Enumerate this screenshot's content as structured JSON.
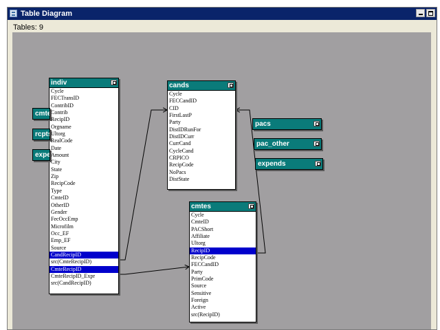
{
  "window": {
    "title": "Table Diagram"
  },
  "status": {
    "tables_label": "Tables: 9"
  },
  "tables": {
    "indiv": {
      "name": "indiv",
      "fields": [
        "Cycle",
        "FECTransID",
        "ContribID",
        "Contrib",
        "RecipID",
        "Orgname",
        "Ultorg",
        "RealCode",
        "Date",
        "Amount",
        "City",
        "State",
        "Zip",
        "RecipCode",
        "Type",
        "CmteID",
        "OtherID",
        "Gender",
        "FecOccEmp",
        "Microfilm",
        "Occ_EF",
        "Emp_EF",
        "Source",
        "CandRecipID",
        "src(CmteRecipID)",
        "CmteRecipID",
        "CmteRecipID_Expr",
        "src(CandRecipID)"
      ],
      "selected": [
        "CandRecipID",
        "CmteRecipID"
      ]
    },
    "cands": {
      "name": "cands",
      "fields": [
        "Cycle",
        "FECCandID",
        "CID",
        "FirstLastP",
        "Party",
        "DistIDRunFor",
        "DistIDCurr",
        "CurrCand",
        "CycleCand",
        "CRPICO",
        "RecipCode",
        "NoPacs",
        "DistState"
      ],
      "selected": []
    },
    "cmtes": {
      "name": "cmtes",
      "fields": [
        "Cycle",
        "CmteID",
        "PACShort",
        "Affiliate",
        "Ultorg",
        "RecipID",
        "RecipCode",
        "FECCandID",
        "Party",
        "PrimCode",
        "Source",
        "Sensitive",
        "Foreign",
        "Active",
        "src(RecipID)"
      ],
      "selected": [
        "RecipID"
      ]
    }
  },
  "collapsed_tables": {
    "left": [
      "cmte",
      "rcpts",
      "expe"
    ],
    "pacs": "pacs",
    "pac_other": "pac_other",
    "expends": "expends"
  },
  "colors": {
    "canvas": "#a19fa1",
    "header": "#0a7b7a",
    "selection": "#0000cc",
    "titlebar": "#0a246a"
  }
}
